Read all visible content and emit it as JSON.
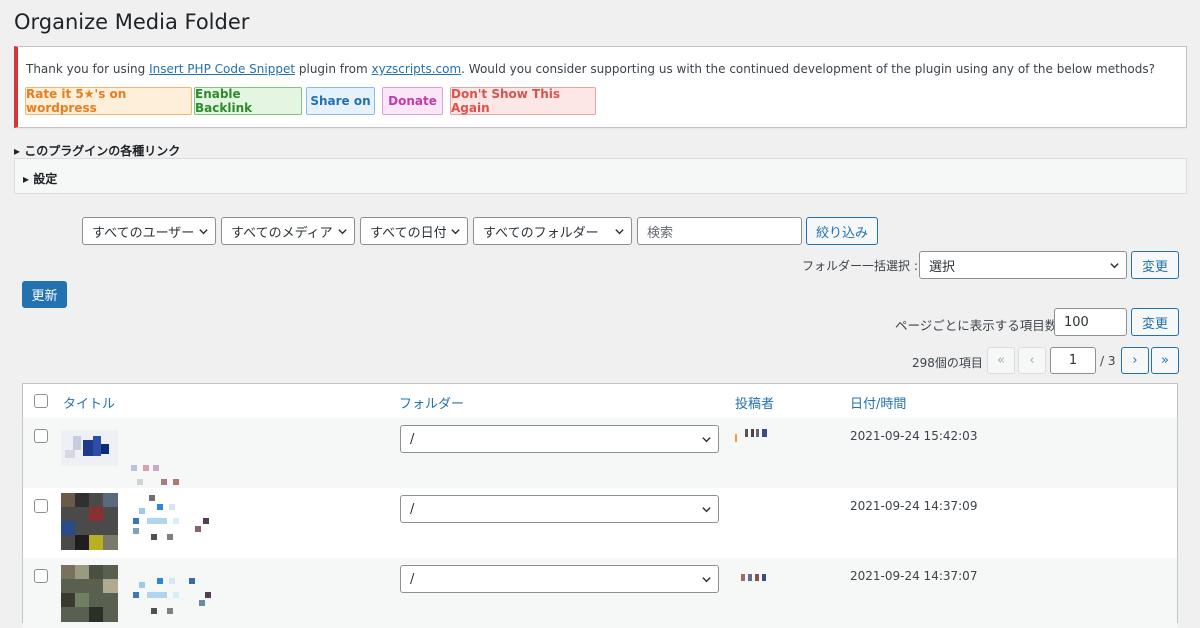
{
  "page": {
    "title": "Organize Media Folder"
  },
  "notice": {
    "text_before": "Thank you for using ",
    "plugin_link": "Insert PHP Code Snippet",
    "text_middle": " plugin from ",
    "site_link": "xyzscripts.com",
    "text_after": ". Would you consider supporting us with the continued development of the plugin using any of the below methods?",
    "buttons": [
      "Rate it 5★'s on wordpress",
      "Enable Backlink",
      "Share on",
      "Donate",
      "Don't Show This Again"
    ]
  },
  "links_toggle": "▸ このプラグインの各種リンク",
  "settings_toggle": "▸ 設定",
  "filters": {
    "users": "すべてのユーザー",
    "media": "すべてのメディア",
    "dates": "すべての日付",
    "folders": "すべてのフォルダー",
    "search_placeholder": "検索",
    "filter_button": "絞り込み"
  },
  "bulk": {
    "label": "フォルダー一括選択 :",
    "select": "選択",
    "apply": "変更"
  },
  "update_button": "更新",
  "per_page": {
    "label": "ページごとに表示する項目数:",
    "value": "100",
    "apply": "変更"
  },
  "pagination": {
    "count": "298個の項目",
    "first": "«",
    "prev": "‹",
    "current": "1",
    "total": "/ 3",
    "next": "›",
    "last": "»"
  },
  "table": {
    "headers": {
      "title": "タイトル",
      "folder": "フォルダー",
      "author": "投稿者",
      "date": "日付/時間"
    },
    "rows": [
      {
        "folder": "/",
        "date": "2021-09-24 15:42:03"
      },
      {
        "folder": "/",
        "date": "2021-09-24 14:37:09"
      },
      {
        "folder": "/",
        "date": "2021-09-24 14:37:07"
      }
    ]
  },
  "colors": {
    "accent": "#2271b1",
    "notice_border": "#d63638"
  }
}
